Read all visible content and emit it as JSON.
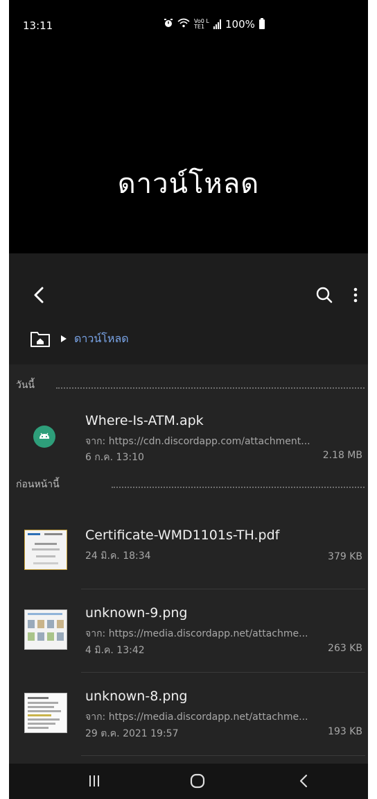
{
  "status": {
    "time": "13:11",
    "network": "Vo0 LTE1",
    "battery": "100%"
  },
  "page_title": "ดาวน์โหลด",
  "breadcrumb": {
    "current": "ดาวน์โหลด"
  },
  "sections": [
    {
      "label": "วันนี้",
      "items": [
        {
          "name": "Where-Is-ATM.apk",
          "source": "จาก: https://cdn.discordapp.com/attachment...",
          "date": "6 ก.ค. 13:10",
          "size": "2.18 MB",
          "icon": "android-apk-icon"
        }
      ]
    },
    {
      "label": "ก่อนหน้านี้",
      "items": [
        {
          "name": "Certificate-WMD1101s-TH.pdf",
          "date": "24 มิ.ค. 18:34",
          "size": "379 KB",
          "icon": "pdf-thumbnail"
        },
        {
          "name": "unknown-9.png",
          "source": "จาก: https://media.discordapp.net/attachme...",
          "date": "4 มิ.ค. 13:42",
          "size": "263 KB",
          "icon": "image-thumbnail"
        },
        {
          "name": "unknown-8.png",
          "source": "จาก: https://media.discordapp.net/attachme...",
          "date": "29 ต.ค. 2021 19:57",
          "size": "193 KB",
          "icon": "image-thumbnail"
        }
      ]
    }
  ],
  "colors": {
    "accent": "#7aa5e8",
    "apk_badge": "#2e9e7a",
    "background": "#242424"
  }
}
